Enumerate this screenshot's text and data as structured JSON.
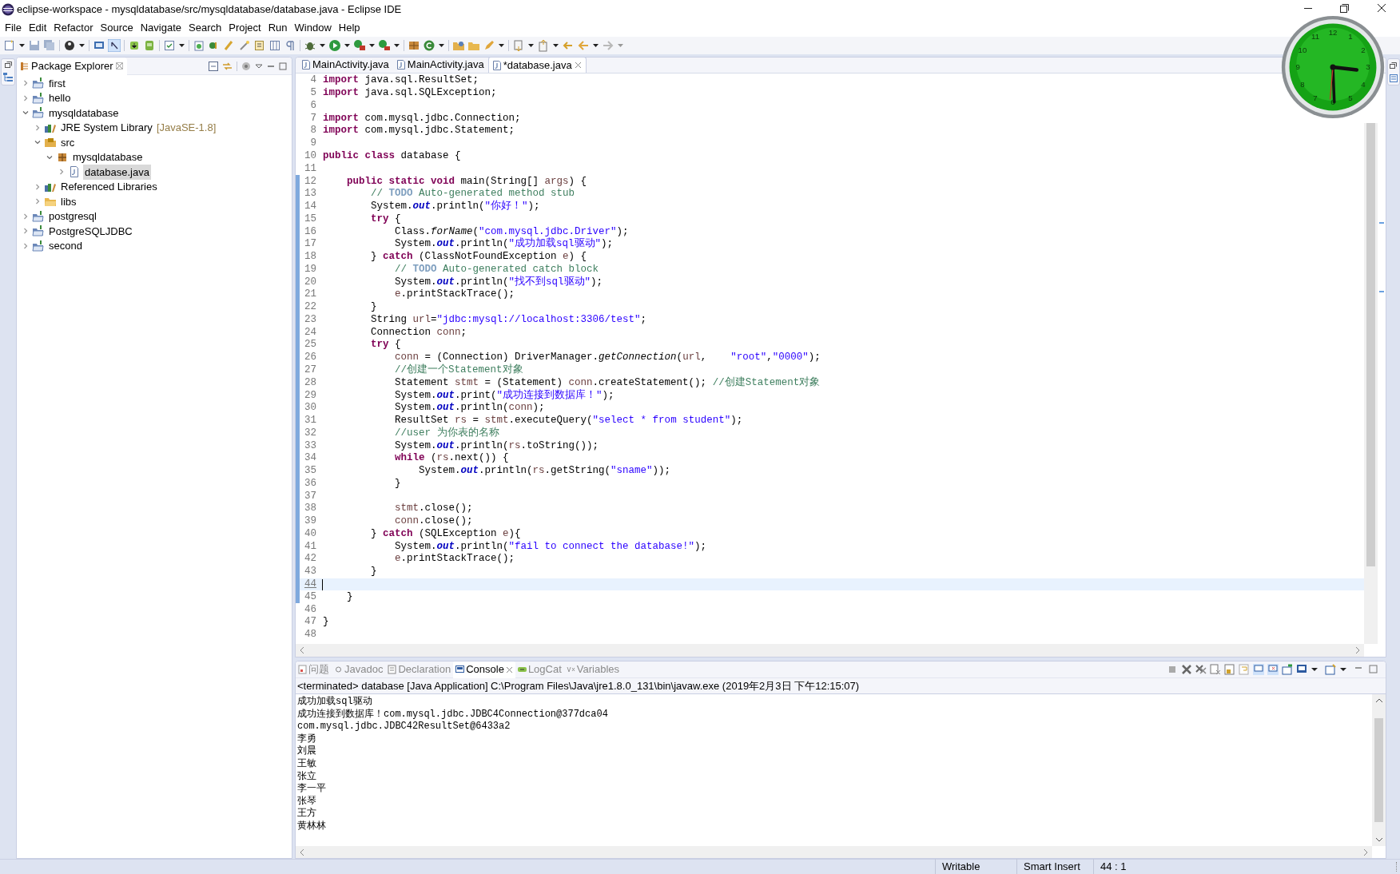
{
  "window": {
    "title": "eclipse-workspace - mysqldatabase/src/mysqldatabase/database.java - Eclipse IDE"
  },
  "menu": [
    "File",
    "Edit",
    "Refactor",
    "Source",
    "Navigate",
    "Search",
    "Project",
    "Run",
    "Window",
    "Help"
  ],
  "package_explorer": {
    "title": "Package Explorer",
    "tree": [
      {
        "label": "first",
        "kind": "project",
        "expanded": false,
        "selected": false
      },
      {
        "label": "hello",
        "kind": "project",
        "expanded": false,
        "selected": false
      },
      {
        "label": "mysqldatabase",
        "kind": "project",
        "expanded": true,
        "selected": false,
        "children": [
          {
            "label": "JRE System Library",
            "decoration": "[JavaSE-1.8]",
            "kind": "library",
            "expanded": false,
            "selected": false
          },
          {
            "label": "src",
            "kind": "source-folder",
            "expanded": true,
            "selected": false,
            "children": [
              {
                "label": "mysqldatabase",
                "kind": "package",
                "expanded": true,
                "selected": false,
                "children": [
                  {
                    "label": "database.java",
                    "kind": "file",
                    "expanded": false,
                    "selected": true
                  }
                ]
              }
            ]
          },
          {
            "label": "Referenced Libraries",
            "kind": "library",
            "expanded": false,
            "selected": false
          },
          {
            "label": "libs",
            "kind": "folder",
            "expanded": false,
            "selected": false
          }
        ]
      },
      {
        "label": "postgresql",
        "kind": "project",
        "expanded": false,
        "selected": false
      },
      {
        "label": "PostgreSQLJDBC",
        "kind": "project",
        "expanded": false,
        "selected": false
      },
      {
        "label": "second",
        "kind": "project",
        "expanded": false,
        "selected": false
      }
    ]
  },
  "editor": {
    "tabs": [
      {
        "label": "MainActivity.java",
        "selected": false
      },
      {
        "label": "MainActivity.java",
        "selected": false
      },
      {
        "label": "*database.java",
        "selected": true
      }
    ],
    "lines": [
      {
        "number": "4",
        "changed": false,
        "current": false,
        "tokens": [
          {
            "kind": "keyword",
            "text": "import"
          },
          {
            "kind": "plain",
            "text": " java.sql.ResultSet;"
          }
        ]
      },
      {
        "number": "5",
        "changed": false,
        "current": false,
        "tokens": [
          {
            "kind": "keyword",
            "text": "import"
          },
          {
            "kind": "plain",
            "text": " java.sql.SQLException;"
          }
        ]
      },
      {
        "number": "6",
        "changed": false,
        "current": false
      },
      {
        "number": "7",
        "changed": false,
        "current": false,
        "tokens": [
          {
            "kind": "keyword",
            "text": "import"
          },
          {
            "kind": "plain",
            "text": " com.mysql.jdbc.Connection;"
          }
        ]
      },
      {
        "number": "8",
        "changed": false,
        "current": false,
        "tokens": [
          {
            "kind": "keyword",
            "text": "import"
          },
          {
            "kind": "plain",
            "text": " com.mysql.jdbc.Statement;"
          }
        ]
      },
      {
        "number": "9",
        "changed": false,
        "current": false
      },
      {
        "number": "10",
        "changed": false,
        "current": false,
        "tokens": [
          {
            "kind": "keyword",
            "text": "public"
          },
          {
            "kind": "keyword",
            "text": " class"
          },
          {
            "kind": "plain",
            "text": " database {"
          }
        ]
      },
      {
        "number": "11",
        "changed": false,
        "current": false
      },
      {
        "number": "12",
        "changed": true,
        "current": false,
        "tokens": [
          {
            "kind": "keyword",
            "text": "    public"
          },
          {
            "kind": "keyword",
            "text": " static"
          },
          {
            "kind": "keyword",
            "text": " void"
          },
          {
            "kind": "plain",
            "text": " main(String[] "
          },
          {
            "kind": "variable",
            "text": "args"
          },
          {
            "kind": "plain",
            "text": ") {"
          }
        ]
      },
      {
        "number": "13",
        "changed": true,
        "current": false,
        "tokens": [
          {
            "kind": "comment",
            "text": "        // "
          },
          {
            "kind": "todo",
            "text": "TODO"
          },
          {
            "kind": "comment",
            "text": " Auto-generated method stub"
          }
        ]
      },
      {
        "number": "14",
        "changed": true,
        "current": false,
        "tokens": [
          {
            "kind": "plain",
            "text": "        System."
          },
          {
            "kind": "field",
            "text": "out"
          },
          {
            "kind": "plain",
            "text": ".println("
          },
          {
            "kind": "string",
            "text": "\"你好！\""
          },
          {
            "kind": "plain",
            "text": ");"
          }
        ]
      },
      {
        "number": "15",
        "changed": true,
        "current": false,
        "tokens": [
          {
            "kind": "keyword",
            "text": "        try"
          },
          {
            "kind": "plain",
            "text": " {"
          }
        ]
      },
      {
        "number": "16",
        "changed": true,
        "current": false,
        "tokens": [
          {
            "kind": "plain",
            "text": "            Class."
          },
          {
            "kind": "static-method",
            "text": "forName"
          },
          {
            "kind": "plain",
            "text": "("
          },
          {
            "kind": "string",
            "text": "\"com.mysql.jdbc.Driver\""
          },
          {
            "kind": "plain",
            "text": ");"
          }
        ]
      },
      {
        "number": "17",
        "changed": true,
        "current": false,
        "tokens": [
          {
            "kind": "plain",
            "text": "            System."
          },
          {
            "kind": "field",
            "text": "out"
          },
          {
            "kind": "plain",
            "text": ".println("
          },
          {
            "kind": "string",
            "text": "\"成功加载sql驱动\""
          },
          {
            "kind": "plain",
            "text": ");"
          }
        ]
      },
      {
        "number": "18",
        "changed": true,
        "current": false,
        "tokens": [
          {
            "kind": "plain",
            "text": "        } "
          },
          {
            "kind": "keyword",
            "text": "catch"
          },
          {
            "kind": "plain",
            "text": " (ClassNotFoundException "
          },
          {
            "kind": "variable",
            "text": "e"
          },
          {
            "kind": "plain",
            "text": ") {"
          }
        ]
      },
      {
        "number": "19",
        "changed": true,
        "current": false,
        "tokens": [
          {
            "kind": "comment",
            "text": "            // "
          },
          {
            "kind": "todo",
            "text": "TODO"
          },
          {
            "kind": "comment",
            "text": " Auto-generated catch block"
          }
        ]
      },
      {
        "number": "20",
        "changed": true,
        "current": false,
        "tokens": [
          {
            "kind": "plain",
            "text": "            System."
          },
          {
            "kind": "field",
            "text": "out"
          },
          {
            "kind": "plain",
            "text": ".println("
          },
          {
            "kind": "string",
            "text": "\"找不到sql驱动\""
          },
          {
            "kind": "plain",
            "text": ");"
          }
        ]
      },
      {
        "number": "21",
        "changed": true,
        "current": false,
        "tokens": [
          {
            "kind": "variable",
            "text": "            e"
          },
          {
            "kind": "plain",
            "text": ".printStackTrace();"
          }
        ]
      },
      {
        "number": "22",
        "changed": true,
        "current": false,
        "tokens": [
          {
            "kind": "plain",
            "text": "        }"
          }
        ]
      },
      {
        "number": "23",
        "changed": true,
        "current": false,
        "tokens": [
          {
            "kind": "plain",
            "text": "        String "
          },
          {
            "kind": "variable",
            "text": "url"
          },
          {
            "kind": "plain",
            "text": "="
          },
          {
            "kind": "string",
            "text": "\"jdbc:mysql://localhost:3306/test\""
          },
          {
            "kind": "plain",
            "text": ";"
          }
        ]
      },
      {
        "number": "24",
        "changed": true,
        "current": false,
        "tokens": [
          {
            "kind": "plain",
            "text": "        Connection "
          },
          {
            "kind": "variable",
            "text": "conn"
          },
          {
            "kind": "plain",
            "text": ";"
          }
        ]
      },
      {
        "number": "25",
        "changed": true,
        "current": false,
        "tokens": [
          {
            "kind": "keyword",
            "text": "        try"
          },
          {
            "kind": "plain",
            "text": " {"
          }
        ]
      },
      {
        "number": "26",
        "changed": true,
        "current": false,
        "tokens": [
          {
            "kind": "variable",
            "text": "            conn"
          },
          {
            "kind": "plain",
            "text": " = (Connection) DriverManager."
          },
          {
            "kind": "static-method",
            "text": "getConnection"
          },
          {
            "kind": "plain",
            "text": "("
          },
          {
            "kind": "variable",
            "text": "url"
          },
          {
            "kind": "plain",
            "text": ",    "
          },
          {
            "kind": "string",
            "text": "\"root\""
          },
          {
            "kind": "plain",
            "text": ","
          },
          {
            "kind": "string",
            "text": "\"0000\""
          },
          {
            "kind": "plain",
            "text": ");"
          }
        ]
      },
      {
        "number": "27",
        "changed": true,
        "current": false,
        "tokens": [
          {
            "kind": "comment",
            "text": "            //创建一个Statement对象"
          }
        ]
      },
      {
        "number": "28",
        "changed": true,
        "current": false,
        "tokens": [
          {
            "kind": "plain",
            "text": "            Statement "
          },
          {
            "kind": "variable",
            "text": "stmt"
          },
          {
            "kind": "plain",
            "text": " = (Statement) "
          },
          {
            "kind": "variable",
            "text": "conn"
          },
          {
            "kind": "plain",
            "text": ".createStatement(); "
          },
          {
            "kind": "comment",
            "text": "//创建Statement对象"
          }
        ]
      },
      {
        "number": "29",
        "changed": true,
        "current": false,
        "tokens": [
          {
            "kind": "plain",
            "text": "            System."
          },
          {
            "kind": "field",
            "text": "out"
          },
          {
            "kind": "plain",
            "text": ".print("
          },
          {
            "kind": "string",
            "text": "\"成功连接到数据库！\""
          },
          {
            "kind": "plain",
            "text": ");"
          }
        ]
      },
      {
        "number": "30",
        "changed": true,
        "current": false,
        "tokens": [
          {
            "kind": "plain",
            "text": "            System."
          },
          {
            "kind": "field",
            "text": "out"
          },
          {
            "kind": "plain",
            "text": ".println("
          },
          {
            "kind": "variable",
            "text": "conn"
          },
          {
            "kind": "plain",
            "text": ");"
          }
        ]
      },
      {
        "number": "31",
        "changed": true,
        "current": false,
        "tokens": [
          {
            "kind": "plain",
            "text": "            ResultSet "
          },
          {
            "kind": "variable",
            "text": "rs"
          },
          {
            "kind": "plain",
            "text": " = "
          },
          {
            "kind": "variable",
            "text": "stmt"
          },
          {
            "kind": "plain",
            "text": ".executeQuery("
          },
          {
            "kind": "string",
            "text": "\"select * from student\""
          },
          {
            "kind": "plain",
            "text": ");"
          }
        ]
      },
      {
        "number": "32",
        "changed": true,
        "current": false,
        "tokens": [
          {
            "kind": "comment",
            "text": "            //user 为你表的名称"
          }
        ]
      },
      {
        "number": "33",
        "changed": true,
        "current": false,
        "tokens": [
          {
            "kind": "plain",
            "text": "            System."
          },
          {
            "kind": "field",
            "text": "out"
          },
          {
            "kind": "plain",
            "text": ".println("
          },
          {
            "kind": "variable",
            "text": "rs"
          },
          {
            "kind": "plain",
            "text": ".toString());"
          }
        ]
      },
      {
        "number": "34",
        "changed": true,
        "current": false,
        "tokens": [
          {
            "kind": "keyword",
            "text": "            while"
          },
          {
            "kind": "plain",
            "text": " ("
          },
          {
            "kind": "variable",
            "text": "rs"
          },
          {
            "kind": "plain",
            "text": ".next()) {"
          }
        ]
      },
      {
        "number": "35",
        "changed": true,
        "current": false,
        "tokens": [
          {
            "kind": "plain",
            "text": "                System."
          },
          {
            "kind": "field",
            "text": "out"
          },
          {
            "kind": "plain",
            "text": ".println("
          },
          {
            "kind": "variable",
            "text": "rs"
          },
          {
            "kind": "plain",
            "text": ".getString("
          },
          {
            "kind": "string",
            "text": "\"sname\""
          },
          {
            "kind": "plain",
            "text": "));"
          }
        ]
      },
      {
        "number": "36",
        "changed": true,
        "current": false,
        "tokens": [
          {
            "kind": "plain",
            "text": "            }"
          }
        ]
      },
      {
        "number": "37",
        "changed": true,
        "current": false
      },
      {
        "number": "38",
        "changed": true,
        "current": false,
        "tokens": [
          {
            "kind": "variable",
            "text": "            stmt"
          },
          {
            "kind": "plain",
            "text": ".close();"
          }
        ]
      },
      {
        "number": "39",
        "changed": true,
        "current": false,
        "tokens": [
          {
            "kind": "variable",
            "text": "            conn"
          },
          {
            "kind": "plain",
            "text": ".close();"
          }
        ]
      },
      {
        "number": "40",
        "changed": true,
        "current": false,
        "tokens": [
          {
            "kind": "plain",
            "text": "        } "
          },
          {
            "kind": "keyword",
            "text": "catch"
          },
          {
            "kind": "plain",
            "text": " (SQLException "
          },
          {
            "kind": "variable",
            "text": "e"
          },
          {
            "kind": "plain",
            "text": "){"
          }
        ]
      },
      {
        "number": "41",
        "changed": true,
        "current": false,
        "tokens": [
          {
            "kind": "plain",
            "text": "            System."
          },
          {
            "kind": "field",
            "text": "out"
          },
          {
            "kind": "plain",
            "text": ".println("
          },
          {
            "kind": "string",
            "text": "\"fail to connect the database!\""
          },
          {
            "kind": "plain",
            "text": ");"
          }
        ]
      },
      {
        "number": "42",
        "changed": true,
        "current": false,
        "tokens": [
          {
            "kind": "variable",
            "text": "            e"
          },
          {
            "kind": "plain",
            "text": ".printStackTrace();"
          }
        ]
      },
      {
        "number": "43",
        "changed": true,
        "current": false,
        "tokens": [
          {
            "kind": "plain",
            "text": "        }"
          }
        ]
      },
      {
        "number": "44",
        "changed": true,
        "current": true
      },
      {
        "number": "45",
        "changed": true,
        "current": false,
        "tokens": [
          {
            "kind": "plain",
            "text": "    }"
          }
        ]
      },
      {
        "number": "46",
        "changed": false,
        "current": false
      },
      {
        "number": "47",
        "changed": false,
        "current": false,
        "tokens": [
          {
            "kind": "plain",
            "text": "}"
          }
        ]
      },
      {
        "number": "48",
        "changed": false,
        "current": false
      }
    ]
  },
  "console_view": {
    "tabs": [
      {
        "label": "问题",
        "selected": false
      },
      {
        "label": "Javadoc",
        "selected": false
      },
      {
        "label": "Declaration",
        "selected": false
      },
      {
        "label": "Console",
        "selected": true
      },
      {
        "label": "LogCat",
        "selected": false
      },
      {
        "label": "Variables",
        "selected": false
      }
    ],
    "header": "<terminated> database [Java Application] C:\\Program Files\\Java\\jre1.8.0_131\\bin\\javaw.exe (2019年2月3日 下午12:15:07)",
    "output": [
      "成功加载sql驱动",
      "成功连接到数据库！com.mysql.jdbc.JDBC4Connection@377dca04",
      "com.mysql.jdbc.JDBC42ResultSet@6433a2",
      "李勇",
      "刘晨",
      "王敏",
      "张立",
      "李一平",
      "张琴",
      "王方",
      "黄林林"
    ]
  },
  "status_bar": {
    "mode": "Writable",
    "insert": "Smart Insert",
    "position": "44 : 1"
  },
  "clock": {
    "numerals": [
      "12",
      "1",
      "2",
      "3",
      "4",
      "5",
      "6",
      "7",
      "8",
      "9",
      "10",
      "11"
    ]
  }
}
